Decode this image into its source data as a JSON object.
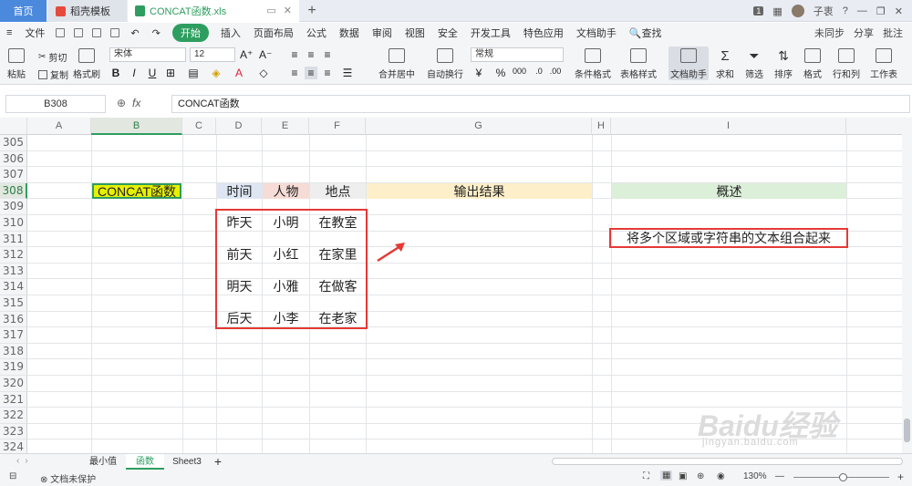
{
  "titlebar": {
    "home_tab": "首页",
    "template_tab": "稻壳模板",
    "file_tab": "CONCAT函数.xls",
    "new_tab": "+",
    "badge": "1",
    "user": "子衷"
  },
  "menubar": {
    "file": "文件",
    "start": "开始",
    "items": [
      "插入",
      "页面布局",
      "公式",
      "数据",
      "审阅",
      "视图",
      "安全",
      "开发工具",
      "特色应用",
      "文档助手"
    ],
    "search": "查找",
    "right": [
      "未同步",
      "分享",
      "批注"
    ]
  },
  "ribbon": {
    "paste": "粘贴",
    "cut": "剪切",
    "copy": "复制",
    "format_painter": "格式刷",
    "font_name": "宋体",
    "font_size": "12",
    "merge_center": "合并居中",
    "wrap": "自动换行",
    "number_format": "常规",
    "conditional_format": "条件格式",
    "table_style": "表格样式",
    "doc_assistant": "文档助手",
    "sum": "求和",
    "filter": "筛选",
    "sort": "排序",
    "format": "格式",
    "row_col": "行和列",
    "worksheet": "工作表"
  },
  "formula": {
    "name_box": "B308",
    "fx": "fx",
    "content": "CONCAT函数"
  },
  "grid": {
    "columns": [
      "A",
      "B",
      "C",
      "D",
      "E",
      "F",
      "G",
      "H",
      "I"
    ],
    "rows": [
      "305",
      "306",
      "307",
      "308",
      "309",
      "310",
      "311",
      "312",
      "313",
      "314",
      "315",
      "316",
      "317",
      "318",
      "319",
      "320",
      "321",
      "322",
      "323",
      "324"
    ],
    "title_cell": "CONCAT函数",
    "headers": {
      "time": "时间",
      "person": "人物",
      "place": "地点",
      "output": "输出结果",
      "overview": "概述"
    },
    "data": [
      {
        "time": "昨天",
        "person": "小明",
        "place": "在教室"
      },
      {
        "time": "前天",
        "person": "小红",
        "place": "在家里"
      },
      {
        "time": "明天",
        "person": "小雅",
        "place": "在做客"
      },
      {
        "time": "后天",
        "person": "小李",
        "place": "在老家"
      }
    ],
    "description": "将多个区域或字符串的文本组合起来"
  },
  "sheets": {
    "tabs": [
      "最小值",
      "函数",
      "Sheet3"
    ],
    "active": "函数",
    "add": "+"
  },
  "status": {
    "protect": "文档未保护",
    "zoom": "130%"
  },
  "watermark": {
    "brand": "Baidu经验",
    "url": "jingyan.baidu.com"
  },
  "colors": {
    "accent": "#2d9e5f",
    "title_bg": "#e6f000",
    "time_bg": "#dde6f2",
    "person_bg": "#f6dcd6",
    "place_bg": "#eeeeee",
    "output_bg": "#fdefc9",
    "overview_bg": "#dcefd9",
    "annotation_red": "#e53935"
  }
}
